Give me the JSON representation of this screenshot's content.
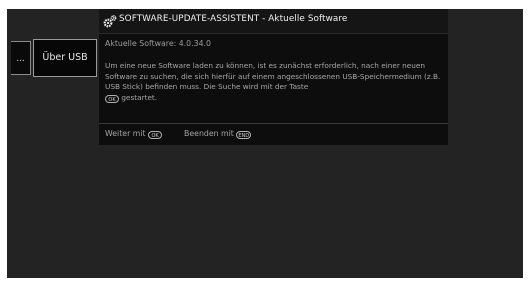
{
  "menu": {
    "left_stub_label": "...",
    "item_label": "Über USB"
  },
  "dialog": {
    "title": "SOFTWARE-UPDATE-ASSISTENT - Aktuelle Software",
    "version_label": "Aktuelle Software:",
    "version_value": "4.0.34.0",
    "description_main": "Um eine neue Software laden zu können, ist es zunächst erforderlich, nach einer neuen Software zu suchen, die sich hierfür auf einem angeschlossenen USB-Speichermedium (z.B. USB Stick) befinden muss. Die Suche wird mit der Taste",
    "description_key": "OK",
    "description_end": "gestartet.",
    "footer": {
      "next_label": "Weiter mit",
      "next_key": "OK",
      "exit_label": "Beenden mit",
      "exit_key": "END"
    }
  },
  "icons": {
    "title_icon": "gears-icon"
  },
  "colors": {
    "screen_bg": "#232323",
    "dialog_bg": "#0d0d0d",
    "title_text": "#f2f2f2",
    "body_text": "#a8a8a8"
  }
}
